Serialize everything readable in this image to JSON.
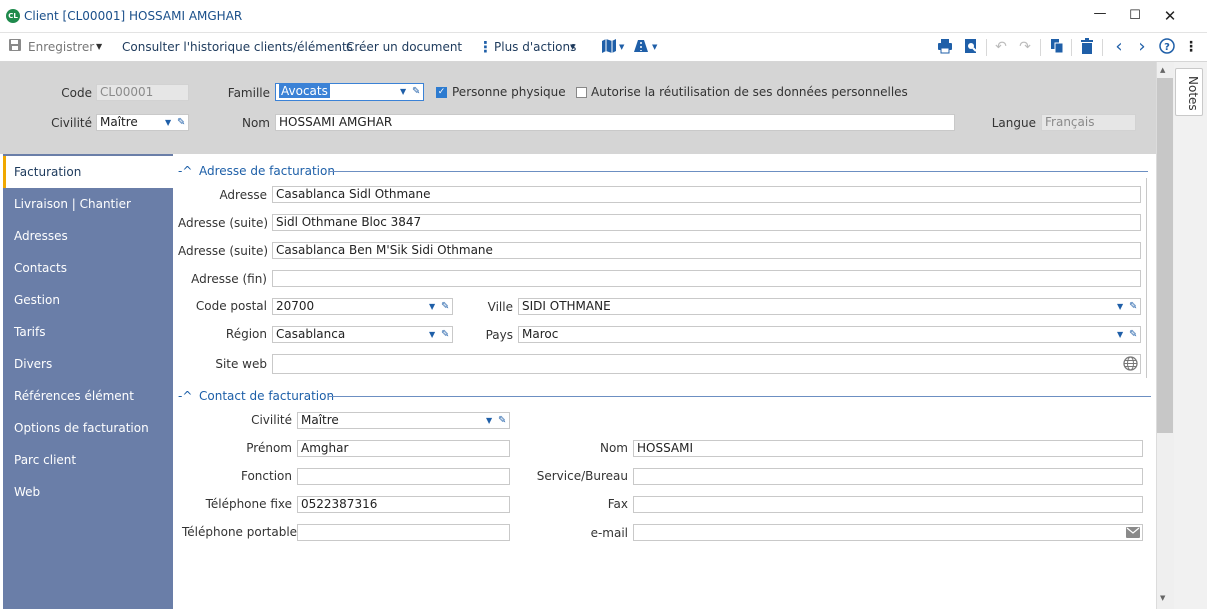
{
  "window": {
    "logo_text": "CL",
    "title": "Client [CL00001] HOSSAMI AMGHAR",
    "minimize_icon": "minimize-icon",
    "maximize_icon": "maximize-icon",
    "close_icon": "close-icon"
  },
  "toolbar": {
    "save_label": "Enregistrer",
    "history_label": "Consulter l'historique clients/éléments",
    "create_doc_label": "Créer un document",
    "more_actions_label": "Plus d'actions",
    "icons": [
      "save-icon",
      "dropdown-icon",
      "more-vertical-icon",
      "map-icon",
      "route-icon",
      "print-icon",
      "preview-icon",
      "undo-icon",
      "redo-icon",
      "copy-icon",
      "delete-icon",
      "previous-icon",
      "next-icon",
      "help-icon",
      "menu-icon"
    ]
  },
  "header": {
    "code_label": "Code",
    "code_value": "CL00001",
    "famille_label": "Famille",
    "famille_value": "Avocats",
    "personne_physique_label": "Personne physique",
    "personne_physique_checked": true,
    "reutilisation_label": "Autorise la réutilisation de ses données personnelles",
    "reutilisation_checked": false,
    "civilite_label": "Civilité",
    "civilite_value": "Maître",
    "nom_label": "Nom",
    "nom_value": "HOSSAMI AMGHAR",
    "langue_label": "Langue",
    "langue_value": "Français"
  },
  "nav": {
    "items": [
      {
        "label": "Facturation",
        "selected": true
      },
      {
        "label": "Livraison | Chantier"
      },
      {
        "label": "Adresses"
      },
      {
        "label": "Contacts"
      },
      {
        "label": "Gestion"
      },
      {
        "label": "Tarifs"
      },
      {
        "label": "Divers"
      },
      {
        "label": "Références élément"
      },
      {
        "label": "Options de facturation"
      },
      {
        "label": "Parc client"
      },
      {
        "label": "Web"
      }
    ]
  },
  "billing_address": {
    "section_title": "Adresse de facturation",
    "adresse_label": "Adresse",
    "adresse_value": "Casablanca Sidl Othmane",
    "adresse_suite_label": "Adresse (suite)",
    "adresse_suite_value": "Sidl Othmane Bloc 3847",
    "adresse_suite2_label": "Adresse (suite)",
    "adresse_suite2_value": "Casablanca Ben M'Sik Sidi Othmane",
    "adresse_fin_label": "Adresse (fin)",
    "adresse_fin_value": "",
    "code_postal_label": "Code postal",
    "code_postal_value": "20700",
    "ville_label": "Ville",
    "ville_value": "SIDI OTHMANE",
    "region_label": "Région",
    "region_value": "Casablanca",
    "pays_label": "Pays",
    "pays_value": "Maroc",
    "site_web_label": "Site web",
    "site_web_value": ""
  },
  "billing_contact": {
    "section_title": "Contact de facturation",
    "civilite_label": "Civilité",
    "civilite_value": "Maître",
    "prenom_label": "Prénom",
    "prenom_value": "Amghar",
    "nom_label": "Nom",
    "nom_value": "HOSSAMI",
    "fonction_label": "Fonction",
    "fonction_value": "",
    "service_label": "Service/Bureau",
    "service_value": "",
    "tel_fixe_label": "Téléphone fixe",
    "tel_fixe_value": "0522387316",
    "fax_label": "Fax",
    "fax_value": "",
    "tel_portable_label": "Téléphone portable",
    "tel_portable_value": "",
    "email_label": "e-mail",
    "email_value": ""
  },
  "side_panel": {
    "notes_label": "Notes"
  },
  "colors": {
    "nav_bg": "#6a7ea8",
    "accent": "#1f5fa8",
    "selected_marker": "#f0a800",
    "header_bg": "#d5d5d5"
  }
}
